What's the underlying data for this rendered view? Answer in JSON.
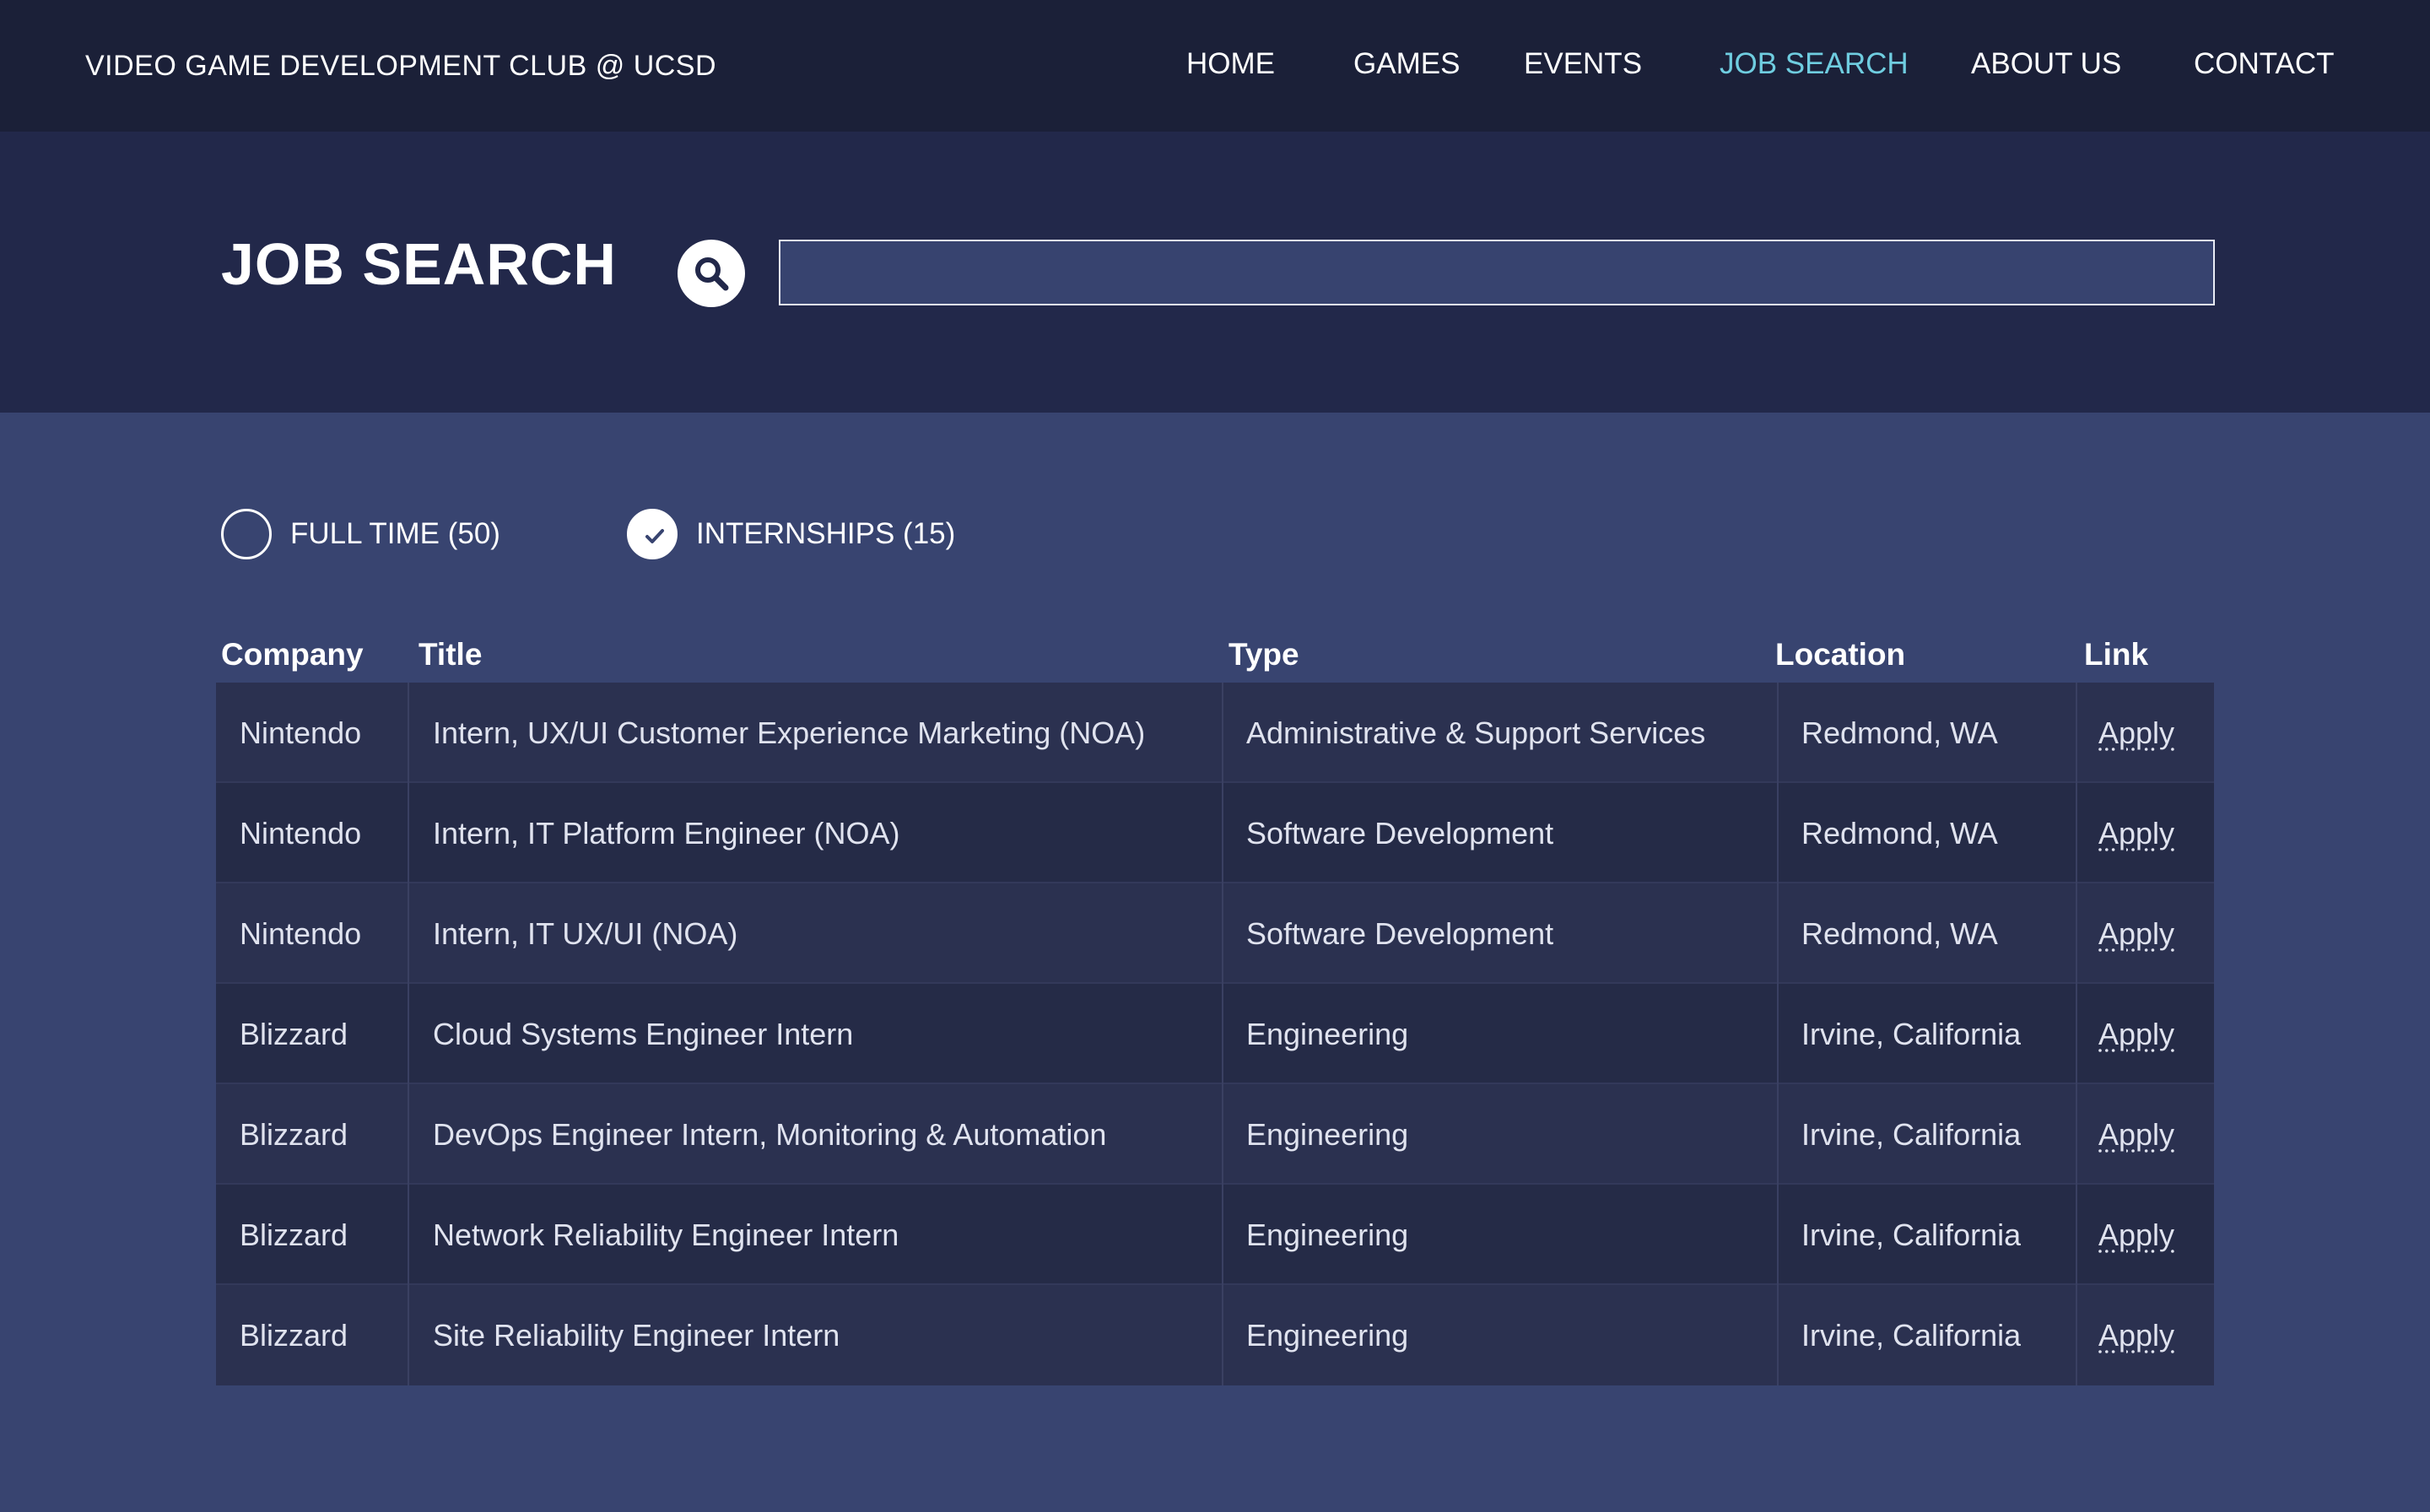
{
  "nav": {
    "brand": "VIDEO GAME DEVELOPMENT CLUB @ UCSD",
    "items": [
      {
        "label": "HOME"
      },
      {
        "label": "GAMES"
      },
      {
        "label": "EVENTS"
      },
      {
        "label": "JOB SEARCH",
        "active": true
      },
      {
        "label": "ABOUT US"
      },
      {
        "label": "CONTACT"
      }
    ]
  },
  "hero": {
    "title": "JOB SEARCH",
    "search_icon": "search-icon",
    "search_value": ""
  },
  "filters": [
    {
      "label": "FULL TIME (50)",
      "checked": false
    },
    {
      "label": "INTERNSHIPS (15)",
      "checked": true
    }
  ],
  "table": {
    "headers": [
      "Company",
      "Title",
      "Type",
      "Location",
      "Link"
    ],
    "rows": [
      {
        "company": "Nintendo",
        "title": "Intern, UX/UI Customer Experience Marketing (NOA)",
        "type": "Administrative & Support Services",
        "location": "Redmond, WA",
        "link": "Apply"
      },
      {
        "company": "Nintendo",
        "title": "Intern, IT Platform Engineer (NOA)",
        "type": "Software Development",
        "location": "Redmond, WA",
        "link": "Apply"
      },
      {
        "company": "Nintendo",
        "title": "Intern, IT UX/UI (NOA)",
        "type": "Software Development",
        "location": "Redmond, WA",
        "link": "Apply"
      },
      {
        "company": "Blizzard",
        "title": "Cloud Systems Engineer Intern",
        "type": "Engineering",
        "location": "Irvine, California",
        "link": "Apply"
      },
      {
        "company": "Blizzard",
        "title": "DevOps Engineer Intern, Monitoring & Automation",
        "type": "Engineering",
        "location": "Irvine, California",
        "link": "Apply"
      },
      {
        "company": "Blizzard",
        "title": "Network Reliability Engineer Intern",
        "type": "Engineering",
        "location": "Irvine, California",
        "link": "Apply"
      },
      {
        "company": "Blizzard",
        "title": "Site Reliability Engineer Intern",
        "type": "Engineering",
        "location": "Irvine, California",
        "link": "Apply"
      }
    ]
  },
  "colors": {
    "nav_bg": "#1b2038",
    "hero_bg": "#22284a",
    "page_bg": "#384470",
    "accent": "#6fcde0"
  }
}
